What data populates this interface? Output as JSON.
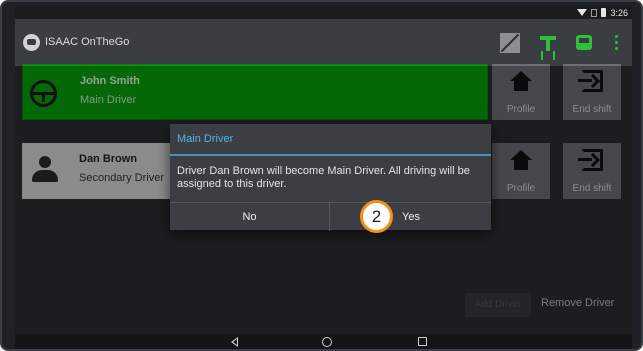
{
  "status": {
    "time": "3:26"
  },
  "app": {
    "title": "ISAAC OnTheGo"
  },
  "drivers": [
    {
      "name": "John Smith",
      "role": "Main Driver",
      "profile_label": "Profile",
      "end_label": "End shift"
    },
    {
      "name": "Dan Brown",
      "role": "Secondary Driver",
      "profile_label": "Profile",
      "end_label": "End shift"
    }
  ],
  "dialog": {
    "title": "Main Driver",
    "message": "Driver Dan Brown will become Main Driver. All driving will be assigned to this driver.",
    "no_label": "No",
    "yes_label": "Yes"
  },
  "actions": {
    "add_label": "Add Driver",
    "remove_label": "Remove Driver"
  },
  "annotation": {
    "step": "2"
  },
  "colors": {
    "accent_green": "#08a00c",
    "dialog_title": "#4db6e6",
    "badge_border": "#f39019"
  }
}
